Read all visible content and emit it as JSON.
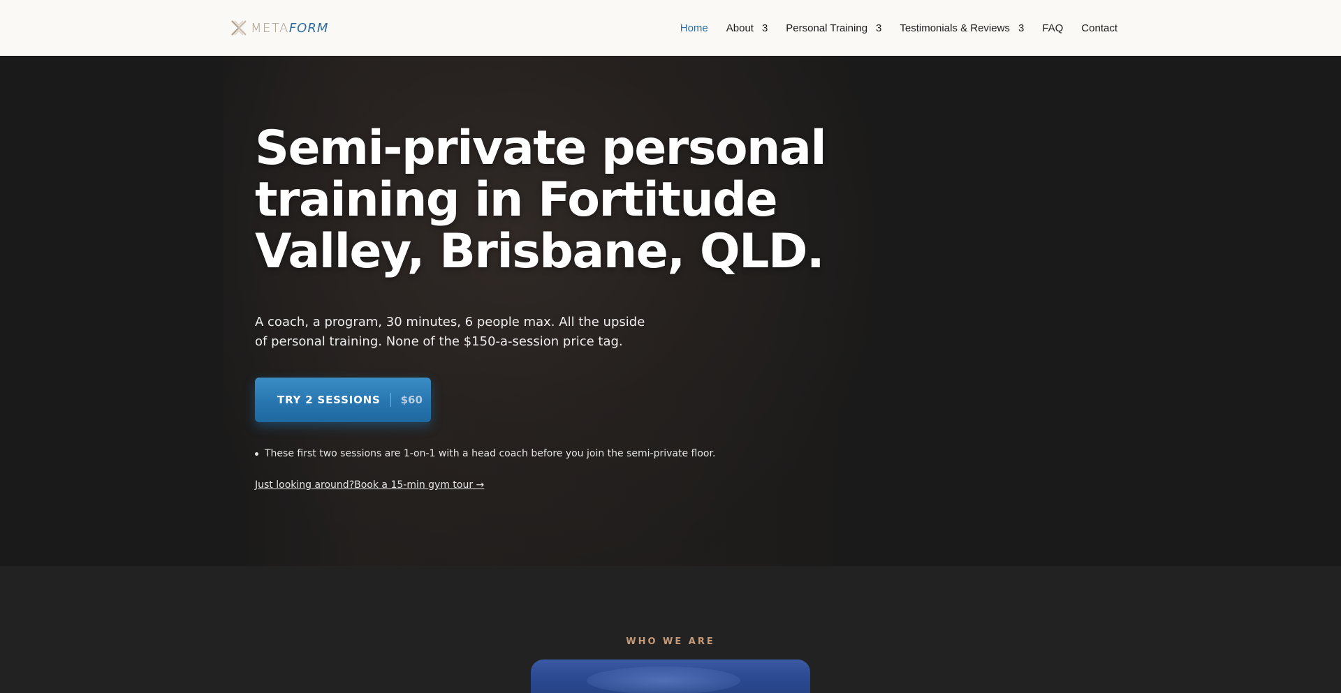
{
  "header": {
    "logo": {
      "part1": "META",
      "part2": "FORM"
    },
    "nav": [
      {
        "label": "Home",
        "active": true,
        "dropdown": false
      },
      {
        "label": "About",
        "active": false,
        "dropdown": true
      },
      {
        "label": "Personal Training",
        "active": false,
        "dropdown": true
      },
      {
        "label": "Testimonials & Reviews",
        "active": false,
        "dropdown": true
      },
      {
        "label": "FAQ",
        "active": false,
        "dropdown": false
      },
      {
        "label": "Contact",
        "active": false,
        "dropdown": false
      }
    ],
    "caret": "3"
  },
  "hero": {
    "title": "Semi-private personal training in Fortitude Valley, Brisbane, QLD.",
    "subtitle": "A coach, a program, 30 minutes, 6 people max. All the upside of personal training. None of the $150-a-session price tag.",
    "cta": {
      "label": "TRY 2 SESSIONS",
      "price": "$60"
    },
    "bullet": "These first two sessions are 1-on-1 with a head coach before you join the semi-private floor.",
    "tour_prefix": "Just looking around?",
    "tour_link": "Book a 15-min gym tour →"
  },
  "section2": {
    "eyebrow": "WHO WE ARE"
  },
  "colors": {
    "accent": "#2b6ea5",
    "cta": "#2876b0",
    "eyebrow": "#c79a77",
    "hero_bg": "#1a1a1a",
    "header_bg": "#faf9f6"
  }
}
